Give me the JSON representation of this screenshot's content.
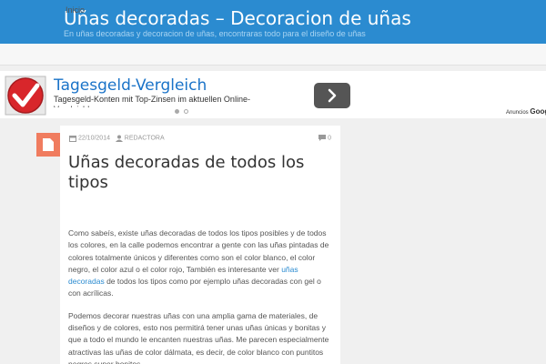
{
  "header": {
    "title": "Uñas decoradas – Decoracion de uñas",
    "description": "En uñas decoradas y decoracion de uñas, encontraras todo para el diseño de uñas"
  },
  "nav": {
    "items": [
      {
        "label": "Inicio"
      }
    ]
  },
  "ad": {
    "title": "Tagesgeld-Vergleich",
    "text": "Tagesgeld-Konten mit Top-Zinsen im aktuellen Online-Vergleich!",
    "choices_prefix": "Anuncios",
    "choices_brand": "Google",
    "colors": {
      "title": "#1a73c8",
      "dot_active": "#aaaaaa",
      "button": "#555555"
    }
  },
  "post": {
    "date": "22/10/2014",
    "author": "REDACTORA",
    "comments": "0",
    "title": "Uñas decoradas de todos los tipos",
    "paragraph1_part1": "Como sabeís, existe uñas decoradas de todos los tipos posibles y de todos los colores, en la calle podemos encontrar a gente con las uñas pintadas de colores totalmente únicos y diferentes como son el color blanco, el color negro, el color azul o el color rojo, También es interesante ver ",
    "paragraph1_link": "uñas decoradas",
    "paragraph1_part2": " de todos los tipos como por ejemplo uñas decoradas con gel o con acrílicas.",
    "paragraph2": "Podemos decorar nuestras uñas con una amplia gama de materiales, de diseños y de colores, esto nos permitirá tener unas uñas únicas y bonitas y que a todo el mundo le encanten nuestras uñas. Me parecen especialmente atractivas las uñas de color dálmata, es decir, de color blanco con puntitos negros super bonitos."
  },
  "colors": {
    "header_bg": "#2b8bd0",
    "badge_bg": "#f07c5f",
    "link": "#2b8bd0"
  },
  "icons": [
    "document-icon",
    "calendar-icon",
    "user-icon",
    "comment-icon",
    "chevron-right-icon",
    "ad-logo-icon"
  ]
}
